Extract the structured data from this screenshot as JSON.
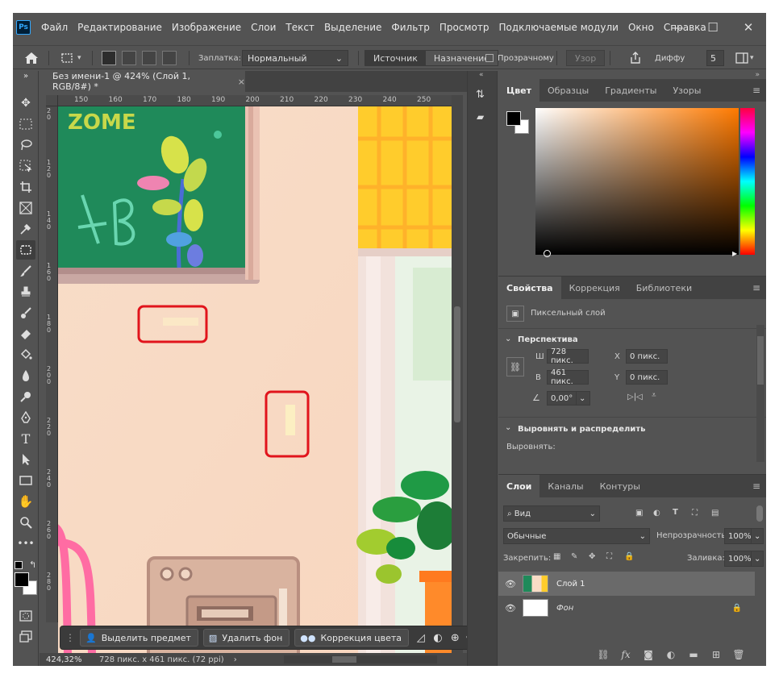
{
  "app": {
    "menu": [
      "Файл",
      "Редактирование",
      "Изображение",
      "Слои",
      "Текст",
      "Выделение",
      "Фильтр",
      "Просмотр",
      "Подключаемые модули",
      "Окно",
      "Справка"
    ],
    "logo": "Ps",
    "window_controls": {
      "minimize": "—",
      "maximize": "☐",
      "close": "✕"
    }
  },
  "options": {
    "patch_label": "Заплатка:",
    "patch_mode": "Нормальный",
    "source": "Источник",
    "destination": "Назначение",
    "transparent": "Прозрачному",
    "pattern": "Узор",
    "diffuse_label": "Диффу",
    "diffuse_value": "5"
  },
  "document": {
    "tab_title": "Без имени-1 @ 424% (Слой 1, RGB/8#) *",
    "close": "×",
    "ruler_h": [
      "150",
      "160",
      "170",
      "180",
      "190",
      "200",
      "210",
      "220",
      "230",
      "240",
      "250"
    ],
    "ruler_v": [
      "2\n0",
      "1\n2\n0",
      "1\n4\n0",
      "1\n6\n0",
      "1\n8\n0",
      "2\n0\n0",
      "2\n2\n0",
      "2\n4\n0",
      "2\n6\n0",
      "2\n8\n0"
    ],
    "zoom": "424,32%",
    "doc_info": "728 пикс. x 461 пикс. (72 ppi)",
    "board_text": "ZOME"
  },
  "taskbar": {
    "select_subject": "Выделить предмет",
    "remove_bg": "Удалить фон",
    "color_correction": "Коррекция цвета"
  },
  "color_panel": {
    "tabs": [
      "Цвет",
      "Образцы",
      "Градиенты",
      "Узоры"
    ],
    "foreground": "#000000",
    "background": "#ffffff",
    "hue_base": "#ff7a00"
  },
  "properties": {
    "tabs": [
      "Свойства",
      "Коррекция",
      "Библиотеки"
    ],
    "layer_type": "Пиксельный слой",
    "perspective": "Перспектива",
    "w_label": "Ш",
    "w_value": "728 пикс.",
    "h_label": "В",
    "h_value": "461 пикс.",
    "x_label": "X",
    "x_value": "0 пикс.",
    "y_label": "Y",
    "y_value": "0 пикс.",
    "angle": "0,00°",
    "align_section": "Выровнять и распределить",
    "align_label": "Выровнять:"
  },
  "layers": {
    "tabs": [
      "Слои",
      "Каналы",
      "Контуры"
    ],
    "filter": "Вид",
    "blend_mode": "Обычные",
    "opacity_label": "Непрозрачность:",
    "opacity_value": "100%",
    "lock_label": "Закрепить:",
    "fill_label": "Заливка:",
    "fill_value": "100%",
    "items": [
      {
        "name": "Слой 1",
        "selected": true
      },
      {
        "name": "Фон",
        "selected": false
      }
    ]
  }
}
